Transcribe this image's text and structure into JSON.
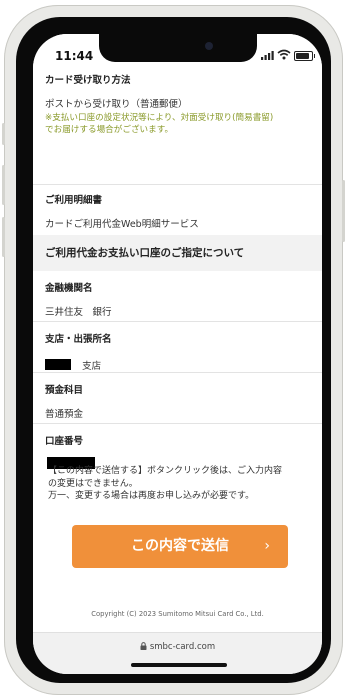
{
  "status": {
    "time": "11:44"
  },
  "sections": {
    "card_receipt": {
      "label": "カード受け取り方法",
      "value": "ポストから受け取り（普通郵便）",
      "note_line1": "※支払い口座の設定状況等により、対面受け取り(簡易書留)",
      "note_line2": "でお届けする場合がございます。"
    },
    "statement": {
      "label": "ご利用明細書",
      "value": "カードご利用代金Web明細サービス"
    },
    "account_heading": "ご利用代金お支払い口座のご指定について",
    "bank": {
      "label": "金融機関名",
      "value": "三井住友　銀行"
    },
    "branch": {
      "label": "支店・出張所名",
      "suffix": "支店"
    },
    "account_type": {
      "label": "預金科目",
      "value": "普通預金"
    },
    "account_number": {
      "label": "口座番号"
    }
  },
  "notice": {
    "line1": "【この内容で送信する】ボタンクリック後は、ご入力内容",
    "line2": "の変更はできません。",
    "line3": "万一、変更する場合は再度お申し込みが必要です。"
  },
  "submit": {
    "label": "この内容で送信",
    "arrow": "›",
    "color": "#f0903a"
  },
  "footer": {
    "copyright": "Copyright (C) 2023 Sumitomo Mitsui Card Co., Ltd."
  },
  "browser": {
    "url": "smbc-card.com",
    "lock_icon": "lock-icon"
  }
}
